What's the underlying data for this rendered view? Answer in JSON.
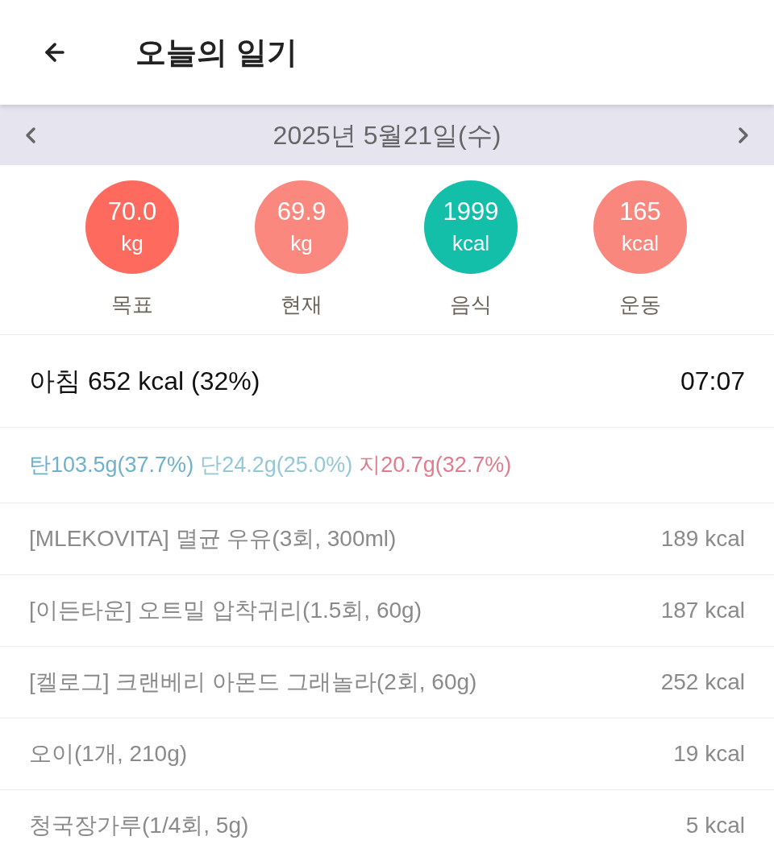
{
  "header": {
    "title": "오늘의 일기"
  },
  "date_bar": {
    "date": "2025년 5월21일(수)"
  },
  "stats": [
    {
      "value": "70.0",
      "unit": "kg",
      "label": "목표",
      "color": "#fe6a5e"
    },
    {
      "value": "69.9",
      "unit": "kg",
      "label": "현재",
      "color": "#fb887f"
    },
    {
      "value": "1999",
      "unit": "kcal",
      "label": "음식",
      "color": "#14bfaa"
    },
    {
      "value": "165",
      "unit": "kcal",
      "label": "운동",
      "color": "#fa877e"
    }
  ],
  "meal": {
    "title": "아침 652 kcal (32%)",
    "time": "07:07"
  },
  "macros": [
    {
      "text": "탄103.5g(37.7%)",
      "color": "#6eb1cb"
    },
    {
      "text": "단24.2g(25.0%)",
      "color": "#95c7d5"
    },
    {
      "text": "지20.7g(32.7%)",
      "color": "#e07c8e"
    }
  ],
  "foods": [
    {
      "name": "[MLEKOVITA] 멸균 우유(3회, 300ml)",
      "calories": "189 kcal"
    },
    {
      "name": "[이든타운] 오트밀 압착귀리(1.5회, 60g)",
      "calories": "187 kcal"
    },
    {
      "name": "[켈로그] 크랜베리 아몬드 그래놀라(2회, 60g)",
      "calories": "252 kcal"
    },
    {
      "name": "오이(1개, 210g)",
      "calories": "19 kcal"
    },
    {
      "name": "청국장가루(1/4회, 5g)",
      "calories": "5 kcal"
    }
  ]
}
